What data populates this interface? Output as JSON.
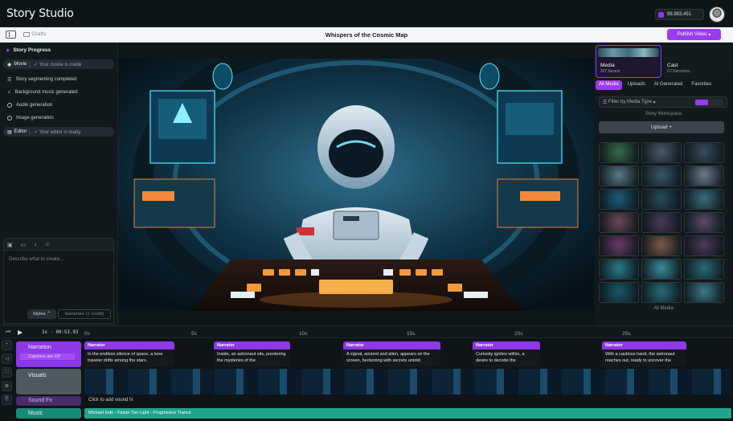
{
  "app": {
    "title": "Story Studio",
    "credits": "99,983,451"
  },
  "subbar": {
    "drafts": "Drafts",
    "project_title": "Whispers of the Cosmic Map",
    "publish": "Publish Video"
  },
  "progress": {
    "title": "Story Progress",
    "movie": {
      "label": "Movie",
      "status": "Your movie is made"
    },
    "steps": [
      "Story segmenting completed",
      "Background music generated",
      "Audio generation",
      "Image generation"
    ],
    "editor": {
      "label": "Editor",
      "status": "Your editor is ready"
    }
  },
  "prompt": {
    "placeholder": "Describe what to create...",
    "styles": "Styles",
    "generate": "Generate (1 credit)"
  },
  "library": {
    "media_tab": {
      "label": "Media",
      "count": "267 Assets"
    },
    "cast_tab": {
      "label": "Cast",
      "count": "0 Characters"
    },
    "subtabs": [
      "All Media",
      "Uploads",
      "AI Generated",
      "Favorites"
    ],
    "filter": "Filter by Media Type",
    "workspace": "Story Workspace",
    "upload": "Upload",
    "all_media": "All Media",
    "thumb_colors": [
      "#3a6a4a",
      "#4a5a6a",
      "#3a4c5e",
      "#5a7888",
      "#3a5868",
      "#6a7a8a",
      "#1e5a78",
      "#2a4a5c",
      "#3a6c80",
      "#6a4a5a",
      "#4a3a5a",
      "#5a4a6a",
      "#6a3a6a",
      "#7a5a4a",
      "#4a3a5a",
      "#2a7a8a",
      "#3a8a9a",
      "#2a6a7a",
      "#1a5a6a",
      "#2a6a7a",
      "#3a7a8a"
    ]
  },
  "timeline": {
    "timecode": "1x · 00:53.93",
    "ticks": [
      "0s",
      "5s",
      "10s",
      "15s",
      "20s",
      "25s"
    ],
    "tracks": {
      "narration": "Narration",
      "captions": "Captions are Off",
      "visuals": "Visuals",
      "sound_fx": "Sound Fx",
      "music": "Music"
    },
    "narration_clips": [
      {
        "speaker": "Narrator",
        "text": "In the endless silence of space, a lone traveler drifts among the stars."
      },
      {
        "speaker": "Narrator",
        "text": "Inside, an astronaut sits, pondering the mysteries of the"
      },
      {
        "speaker": "Narrator",
        "text": "A signal, ancient and alien, appears on the screen, beckoning with secrets untold."
      },
      {
        "speaker": "Narrator",
        "text": "Curiosity ignites within, a desire to decode the"
      },
      {
        "speaker": "Narrator",
        "text": "With a cautious hand, the astronaut reaches out, ready to uncover the"
      }
    ],
    "sfx_hint": "Click to add sound fx",
    "music_track": "Michael Inde - Faster Tan Light - Progressive Trance"
  }
}
